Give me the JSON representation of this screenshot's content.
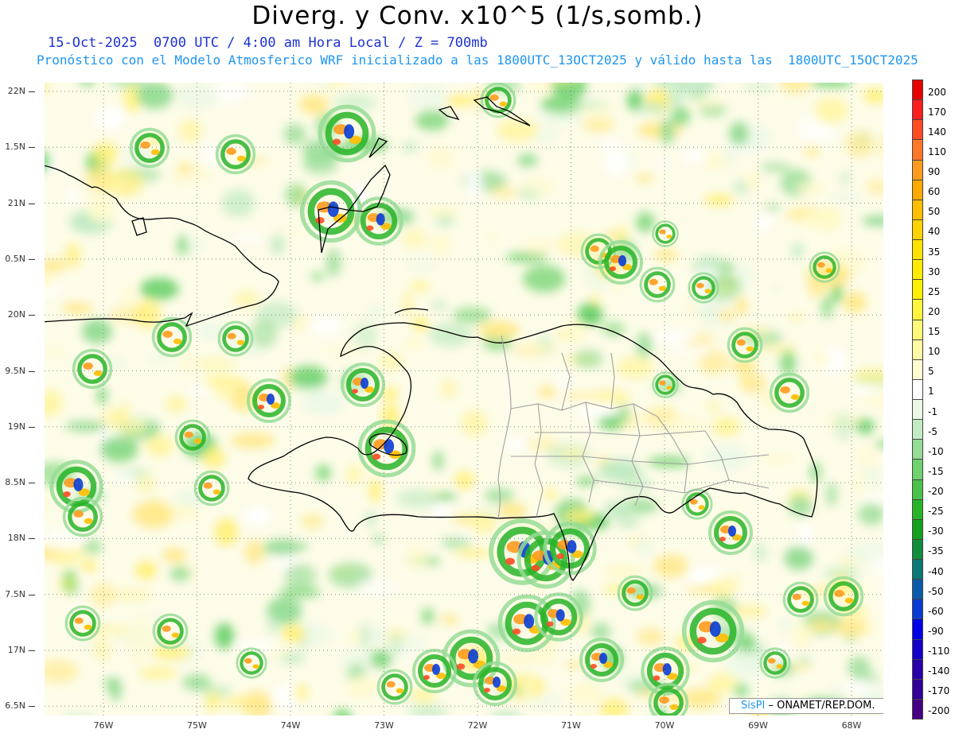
{
  "header": {
    "title": "Diverg. y Conv. x10^5 (1/s,somb.)",
    "date_line": "15-Oct-2025  0700 UTC / 4:00 am Hora Local / Z = 700mb",
    "forecast_line": "Pronóstico con el Modelo Atmosferico WRF inicializado a las 1800UTC_13OCT2025 y válido hasta las  1800UTC_15OCT2025"
  },
  "axes": {
    "lat_labels": [
      "22N",
      "1.5N",
      "21N",
      "0.5N",
      "20N",
      "9.5N",
      "19N",
      "8.5N",
      "18N",
      "7.5N",
      "17N",
      "6.5N"
    ],
    "lon_labels": [
      "76W",
      "75W",
      "74W",
      "73W",
      "72W",
      "71W",
      "70W",
      "69W",
      "68W"
    ]
  },
  "colorbar": {
    "labels": [
      "200",
      "170",
      "140",
      "110",
      "90",
      "60",
      "50",
      "40",
      "35",
      "30",
      "25",
      "20",
      "15",
      "10",
      "5",
      "1",
      "-1",
      "-5",
      "-10",
      "-15",
      "-20",
      "-25",
      "-30",
      "-35",
      "-40",
      "-50",
      "-60",
      "-90",
      "-110",
      "-140",
      "-170",
      "-200"
    ],
    "colors": [
      "#e60000",
      "#ff1e1e",
      "#ff4b23",
      "#ff7828",
      "#ff9b1e",
      "#ffaa00",
      "#ffbe00",
      "#ffd200",
      "#ffe100",
      "#ffeb00",
      "#fff000",
      "#fff53c",
      "#fff878",
      "#fffaa5",
      "#fffcd2",
      "#ffffff",
      "#ebf8e6",
      "#c3ebc3",
      "#96dc96",
      "#6ed26e",
      "#4bc34b",
      "#28b428",
      "#14a01e",
      "#0f8c3c",
      "#0a7873",
      "#0a5aaa",
      "#0a3cd2",
      "#0000e6",
      "#1400c8",
      "#2800aa",
      "#320096",
      "#460082"
    ]
  },
  "credit": {
    "logo": "SisPI",
    "text": "– ONAMET/REP.DOM."
  },
  "map_colors": {
    "background": "#fdfce8",
    "coastline": "#000000",
    "provinces": "#a0a0a0",
    "gridlines": "#888888"
  }
}
